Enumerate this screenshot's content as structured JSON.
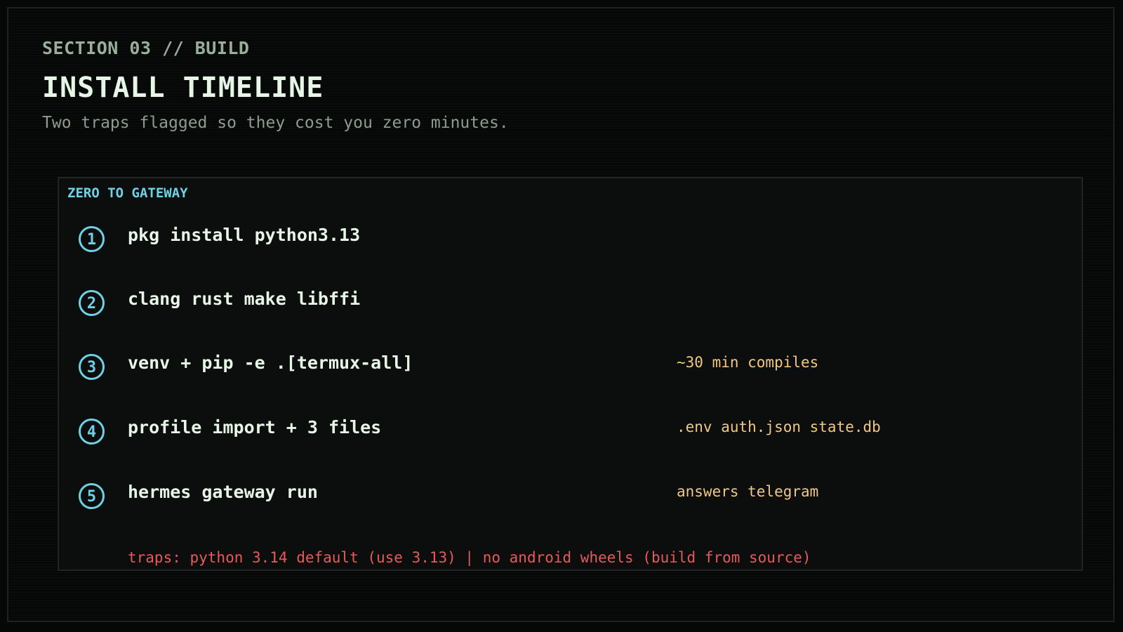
{
  "header": {
    "section_label": "SECTION 03 // BUILD",
    "title": "INSTALL TIMELINE",
    "subtitle": "Two traps flagged so they cost you zero minutes."
  },
  "panel": {
    "title": "ZERO TO GATEWAY",
    "steps": [
      {
        "number": "1",
        "command": "pkg install python3.13",
        "note": ""
      },
      {
        "number": "2",
        "command": "clang rust make libffi",
        "note": ""
      },
      {
        "number": "3",
        "command": "venv + pip -e .[termux-all]",
        "note": "~30 min compiles"
      },
      {
        "number": "4",
        "command": "profile import + 3 files",
        "note": ".env auth.json state.db"
      },
      {
        "number": "5",
        "command": "hermes gateway run",
        "note": "answers telegram"
      }
    ],
    "traps": "traps: python 3.14 default (use 3.13) | no android wheels (build from source)"
  },
  "colors": {
    "background": "#060807",
    "accent_cyan": "#6fd1e8",
    "note_amber": "#f2c786",
    "trap_red": "#e85a5a",
    "title_text": "#e6f5e6",
    "muted_text": "#8e9c90"
  }
}
